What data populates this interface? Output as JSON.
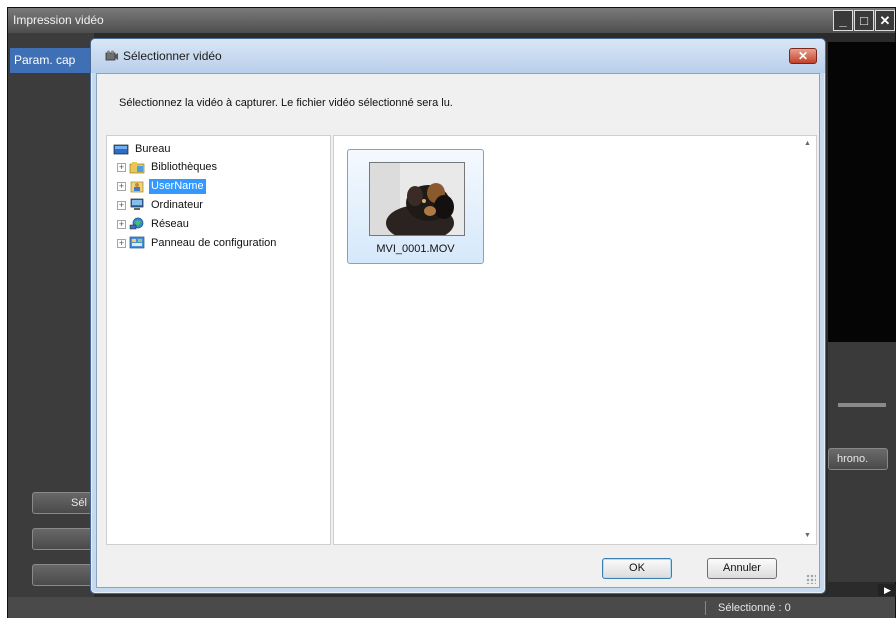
{
  "app": {
    "title": "Impression vidéo",
    "tab_label": "Param. cap",
    "side_buttons": [
      "Sél",
      "",
      ""
    ],
    "chrono_label": "hrono.",
    "status_text": "Sélectionné : 0",
    "window_buttons": [
      "minimize-icon",
      "maximize-icon",
      "close-icon"
    ]
  },
  "dialog": {
    "title": "Sélectionner vidéo",
    "instruction": "Sélectionnez la vidéo à capturer. Le fichier vidéo sélectionné sera lu.",
    "tree": {
      "root": "Bureau",
      "items": [
        {
          "label": "Bibliothèques",
          "icon": "library-icon"
        },
        {
          "label": "UserName",
          "icon": "user-folder-icon",
          "selected": true
        },
        {
          "label": "Ordinateur",
          "icon": "computer-icon"
        },
        {
          "label": "Réseau",
          "icon": "network-icon"
        },
        {
          "label": "Panneau de configuration",
          "icon": "control-panel-icon"
        }
      ]
    },
    "files": [
      {
        "name": "MVI_0001.MOV",
        "selected": true
      }
    ],
    "ok_label": "OK",
    "cancel_label": "Annuler"
  },
  "colors": {
    "selection": "#3399ff",
    "app_tab": "#3f6fb5",
    "dialog_frame": "#c7d9ef"
  }
}
